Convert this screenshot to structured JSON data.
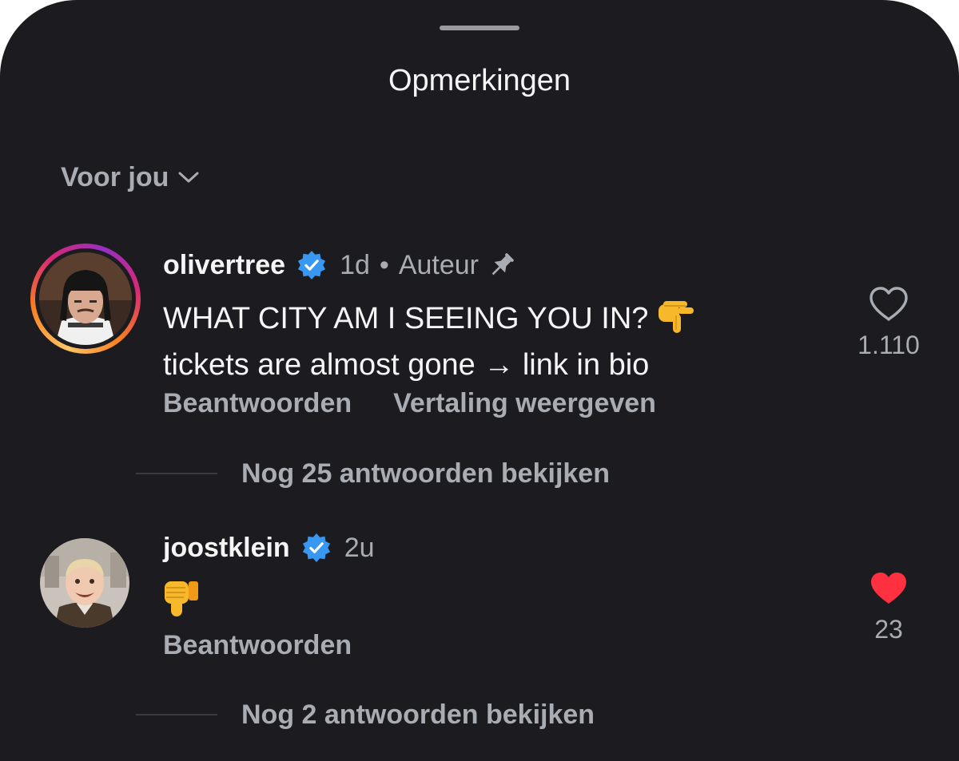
{
  "sheet": {
    "title": "Opmerkingen"
  },
  "sort": {
    "label": "Voor jou",
    "icon": "chevron-down-icon"
  },
  "comments": [
    {
      "username": "olivertree",
      "verified": true,
      "time": "1d",
      "separator": "•",
      "role": "Auteur",
      "pinned": true,
      "text_lines": [
        "WHAT CITY AM I SEEING YOU IN?",
        "tickets are almost gone → link in bio"
      ],
      "text_emoji": "pointing-down-hand-emoji",
      "actions": {
        "reply": "Beantwoorden",
        "translate": "Vertaling weergeven"
      },
      "likes": "1.110",
      "liked": false,
      "view_replies": "Nog 25 antwoorden bekijken",
      "avatar_story_ring": true
    },
    {
      "username": "joostklein",
      "verified": true,
      "time": "2u",
      "text_emoji": "thumbs-down-emoji",
      "actions": {
        "reply": "Beantwoorden"
      },
      "likes": "23",
      "liked": true,
      "view_replies": "Nog 2 antwoorden bekijken"
    }
  ],
  "colors": {
    "background": "#1b1b20",
    "primary_text": "#f5f5f5",
    "secondary_text": "#a9acb3",
    "verified_blue": "#3897f0",
    "like_red": "#ff3040"
  }
}
